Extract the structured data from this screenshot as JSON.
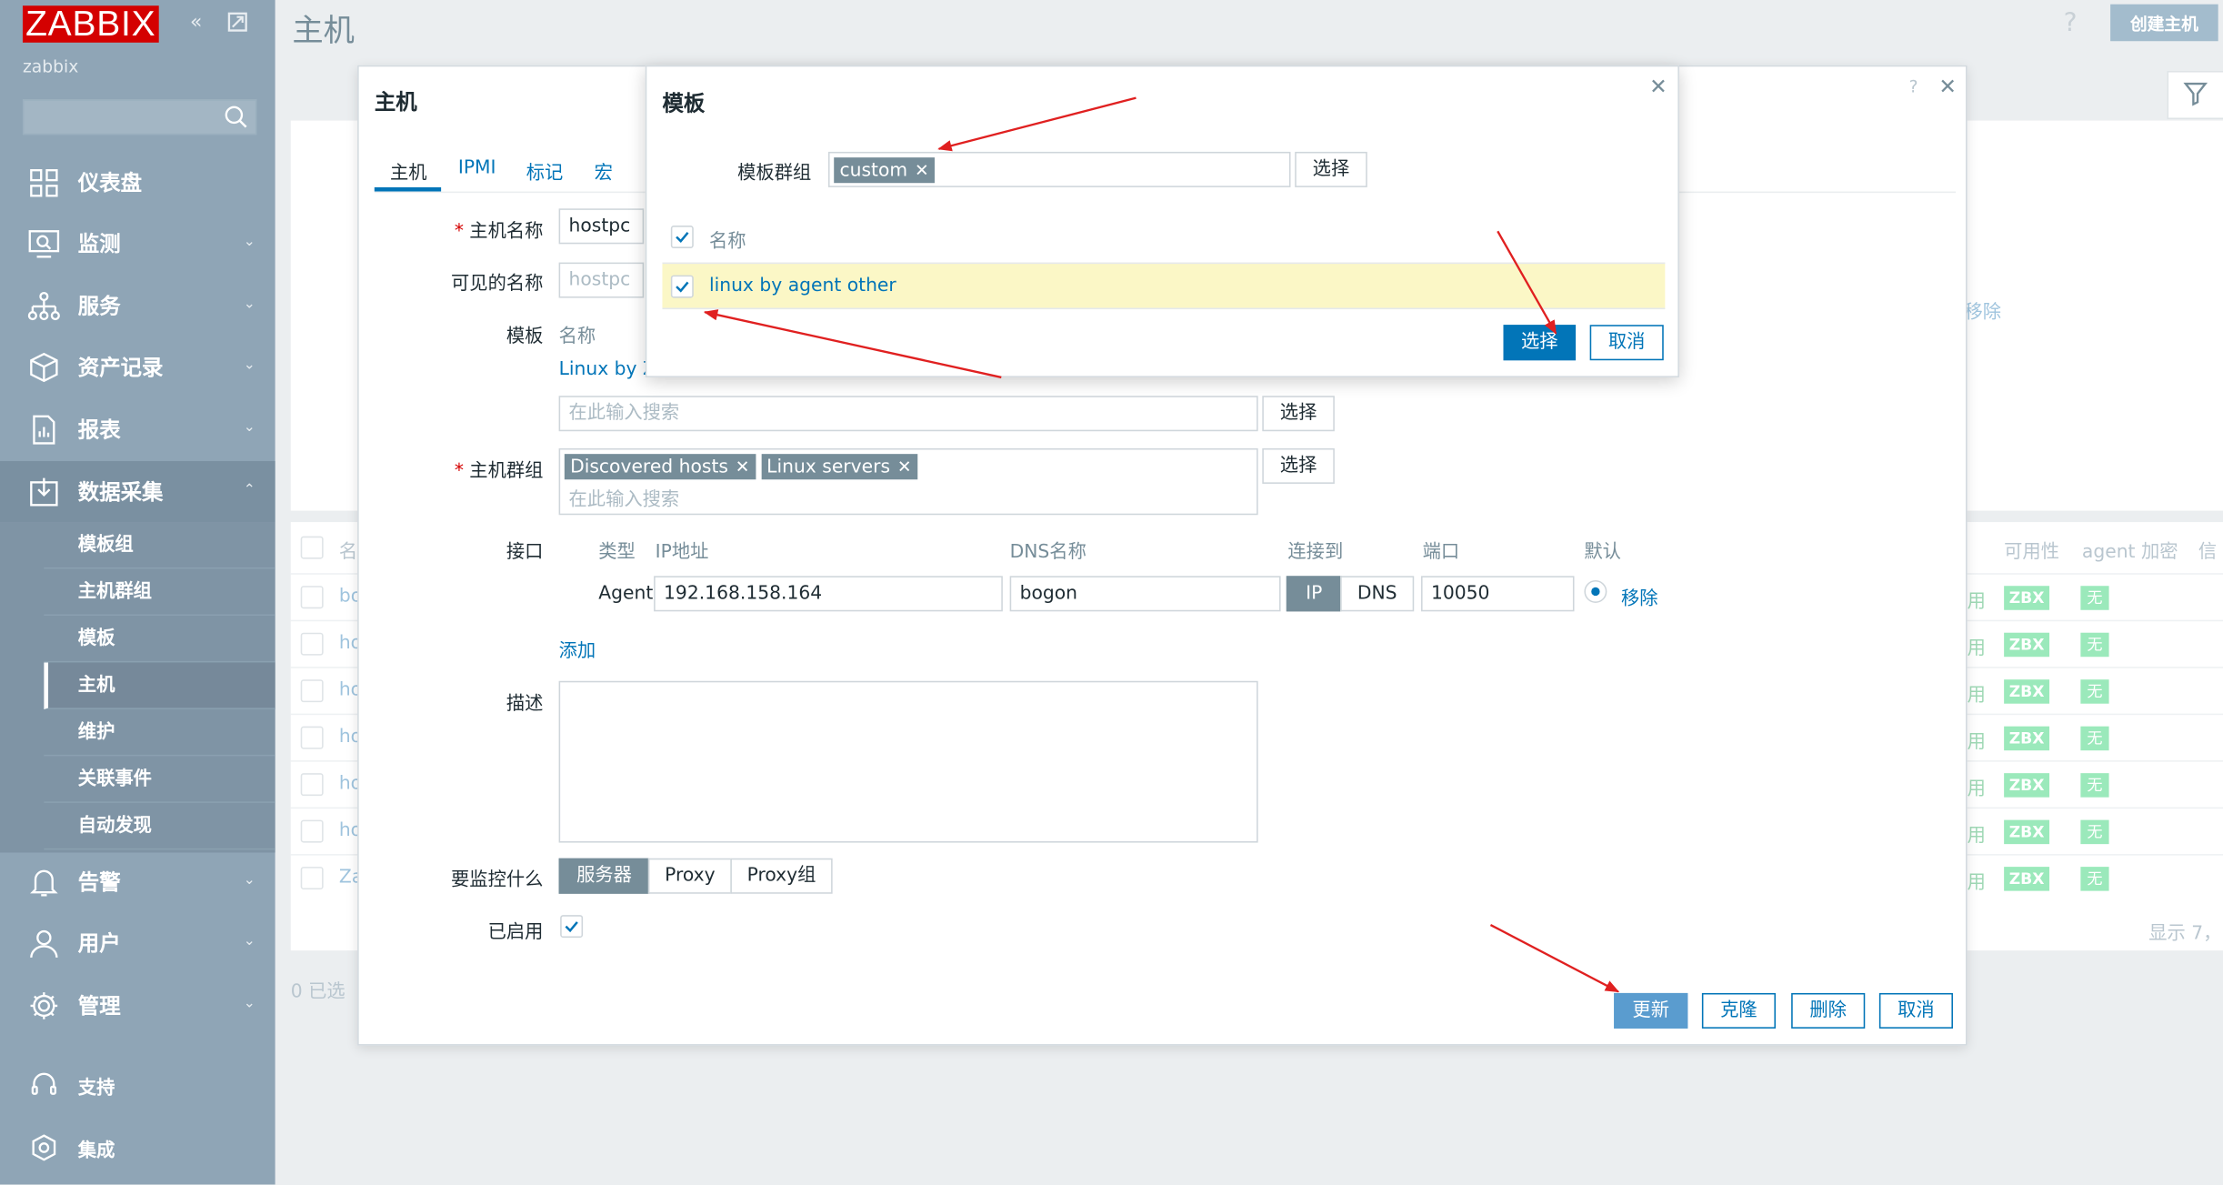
{
  "sidebar": {
    "logo": "ZABBIX",
    "server_name": "zabbix",
    "nav": [
      {
        "label": "仪表盘",
        "icon": "dashboard-icon"
      },
      {
        "label": "监测",
        "icon": "monitoring-icon"
      },
      {
        "label": "服务",
        "icon": "services-icon"
      },
      {
        "label": "资产记录",
        "icon": "inventory-icon"
      },
      {
        "label": "报表",
        "icon": "reports-icon"
      },
      {
        "label": "数据采集",
        "icon": "data-collection-icon"
      }
    ],
    "sub_items": [
      "模板组",
      "主机群组",
      "模板",
      "主机",
      "维护",
      "关联事件",
      "自动发现"
    ],
    "nav_bottom": [
      {
        "label": "告警",
        "icon": "bell-icon"
      },
      {
        "label": "用户",
        "icon": "users-icon"
      },
      {
        "label": "管理",
        "icon": "gear-icon"
      }
    ],
    "footer": [
      {
        "label": "支持",
        "icon": "headset-icon"
      },
      {
        "label": "集成",
        "icon": "integrations-icon"
      }
    ]
  },
  "header": {
    "title": "主机",
    "help": "?",
    "create_button": "创建主机"
  },
  "background": {
    "col_name_partial": "名",
    "remove_link_partial": "移除",
    "col_availability": "可用性",
    "col_agent_encryption": "agent 加密",
    "col_info_partial": "信",
    "rows": [
      {
        "name_partial": "bo",
        "status_partial": "用",
        "availability": "ZBX",
        "encryption": "无"
      },
      {
        "name_partial": "ho",
        "status_partial": "用",
        "availability": "ZBX",
        "encryption": "无"
      },
      {
        "name_partial": "ho",
        "status_partial": "用",
        "availability": "ZBX",
        "encryption": "无"
      },
      {
        "name_partial": "ho",
        "status_partial": "用",
        "availability": "ZBX",
        "encryption": "无"
      },
      {
        "name_partial": "ho",
        "status_partial": "用",
        "availability": "ZBX",
        "encryption": "无"
      },
      {
        "name_partial": "ho",
        "status_partial": "用",
        "availability": "ZBX",
        "encryption": "无"
      },
      {
        "name_partial": "Za",
        "status_partial": "用",
        "availability": "ZBX",
        "encryption": "无"
      }
    ],
    "footer_count_partial": "显示 7，",
    "selected_count": "0 已选"
  },
  "host_dialog": {
    "title": "主机",
    "help": "?",
    "tabs": [
      "主机",
      "IPMI",
      "标记",
      "宏"
    ],
    "host_name_label": "主机名称",
    "host_name_value": "hostpc",
    "visible_name_label": "可见的名称",
    "visible_name_value": "hostpc",
    "templates_label": "模板",
    "templates_col_name": "名称",
    "linked_template_partial": "Linux by Z",
    "templates_search_placeholder": "在此输入搜索",
    "select_label": "选择",
    "host_groups_label": "主机群组",
    "host_groups": [
      "Discovered hosts",
      "Linux servers"
    ],
    "host_groups_placeholder": "在此输入搜索",
    "interfaces_label": "接口",
    "interface_cols": {
      "type": "类型",
      "ip": "IP地址",
      "dns": "DNS名称",
      "connect_to": "连接到",
      "port": "端口",
      "default": "默认"
    },
    "interface": {
      "type": "Agent",
      "ip": "192.168.158.164",
      "dns": "bogon",
      "connect_ip": "IP",
      "connect_dns": "DNS",
      "port": "10050",
      "remove": "移除"
    },
    "add_link": "添加",
    "description_label": "描述",
    "description_value": "",
    "monitored_by_label": "要监控什么",
    "monitored_by_options": [
      "服务器",
      "Proxy",
      "Proxy组"
    ],
    "enabled_label": "已启用",
    "buttons": {
      "update": "更新",
      "clone": "克隆",
      "delete": "删除",
      "cancel": "取消"
    }
  },
  "template_dialog": {
    "title": "模板",
    "group_label": "模板群组",
    "group_chip": "custom",
    "select_button": "选择",
    "col_name": "名称",
    "rows": [
      {
        "name": "linux by agent other",
        "checked": true
      }
    ],
    "confirm_button": "选择",
    "cancel_button": "取消"
  },
  "colors": {
    "sidebar": "#8fa5b6",
    "accent": "#0275b8",
    "brand": "#d40000",
    "selected_row": "#fbf7c6",
    "annotation_arrow": "#e02020"
  }
}
